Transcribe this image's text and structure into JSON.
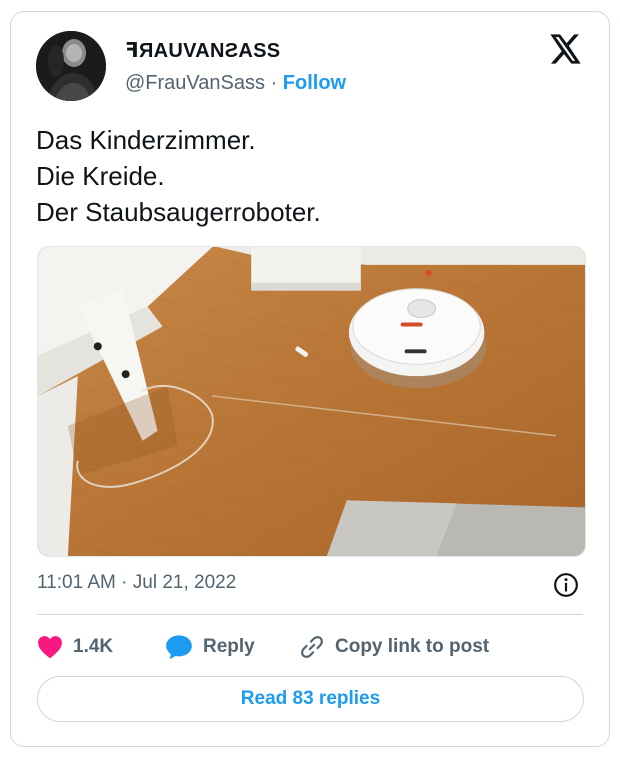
{
  "author": {
    "display_name": "ꟻЯAUVANƧASS",
    "handle": "@FrauVanSass",
    "separator": "·",
    "follow_label": "Follow"
  },
  "tweet": {
    "lines": [
      "Das Kinderzimmer.",
      "Die Kreide.",
      "Der Staubsaugerroboter."
    ]
  },
  "meta": {
    "timestamp": "11:01 AM · Jul 21, 2022"
  },
  "actions": {
    "like_count": "1.4K",
    "reply_label": "Reply",
    "copy_label": "Copy link to post"
  },
  "read_replies_label": "Read 83 replies",
  "icons": {
    "brand": "x-logo-icon",
    "info": "info-icon",
    "like": "heart-icon",
    "reply": "speech-bubble-icon",
    "copy": "link-icon"
  },
  "colors": {
    "accent": "#1d9bf0",
    "like": "#f91880",
    "text": "#0f1419",
    "muted": "#536471",
    "border": "#cfd9de"
  }
}
